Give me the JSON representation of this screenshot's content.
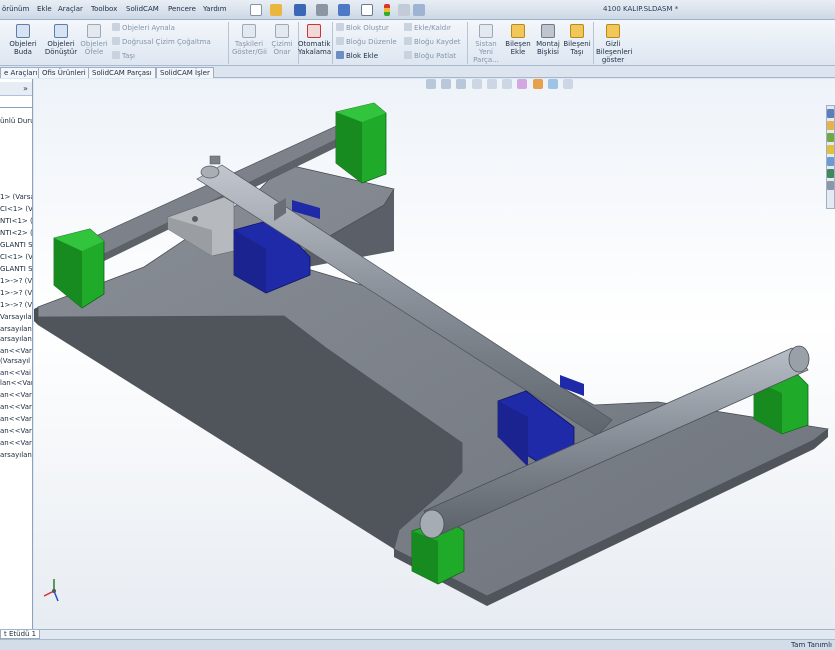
{
  "menu": {
    "items": [
      "örünüm",
      "Ekle",
      "Araçlar",
      "Toolbox",
      "SolidCAM",
      "Pencere",
      "Yardım"
    ],
    "document_title": "4100 KALIP.SLDASM *"
  },
  "ribbon": {
    "big_buttons": [
      {
        "label": "Objeleri Buda"
      },
      {
        "label": "Objeleri Dönüştür"
      },
      {
        "label": "Objeleri Öfele"
      },
      {
        "label": "Taşkileri Göster/Gii"
      },
      {
        "label": "Çizimi Onar"
      },
      {
        "label": "Otomatik Yakalama"
      },
      {
        "label": "Sistan Yeni Parça..."
      },
      {
        "label": "Bileşen Ekle"
      },
      {
        "label": "Montaj Bişkisi"
      },
      {
        "label": "Bileşeni Taşı"
      },
      {
        "label": "Gizli Bileşenleri göster"
      }
    ],
    "small_buttons": [
      {
        "label": "Objeleri Aynala"
      },
      {
        "label": "Doğrusal Çizim Çoğaltma"
      },
      {
        "label": "Taşı"
      },
      {
        "label": "Blok Oluştur"
      },
      {
        "label": "Bloğu Düzenle"
      },
      {
        "label": "Blok Ekle"
      },
      {
        "label": "Ekle/Kaldır"
      },
      {
        "label": "Bloğu Kaydet"
      },
      {
        "label": "Bloğu Patlat"
      }
    ]
  },
  "command_tabs": [
    "e Araçları",
    "Ofis Ürünleri",
    "SolidCAM Parçası",
    "SolidCAM İşler"
  ],
  "feature_manager": {
    "header_button": "»",
    "rows": [
      "ünlü Duru",
      "1> (Varsa",
      "CI<1> (Va",
      "NTI<1> (V",
      "NTI<2> (V",
      "GLANTI S",
      "CI<1> (Va",
      "GLANTI S",
      "1>->? (V",
      "1>->? (V",
      "1>->? (V",
      "Varsayılan<Gö",
      "arsayılan<-",
      "arsayılan<-",
      "an<<Varsayı",
      "(Varsayıl",
      "an<<Vai",
      "lan<<Var",
      "an<<Varsa",
      "an<<Varsa",
      "an<<Varsa",
      "an<<Varsa",
      "an<<Varsa",
      "arsayılan>"
    ]
  },
  "bottom_tab": "t Etüdü 1",
  "status": "Tam Tanımlı",
  "colors": {
    "plate": "#7e838b",
    "plate_side": "#5b6068",
    "rod": "#9097a0",
    "support_green": "#1faa2a",
    "block_blue": "#1f2aa8",
    "bracket": "#b6b9bd"
  }
}
